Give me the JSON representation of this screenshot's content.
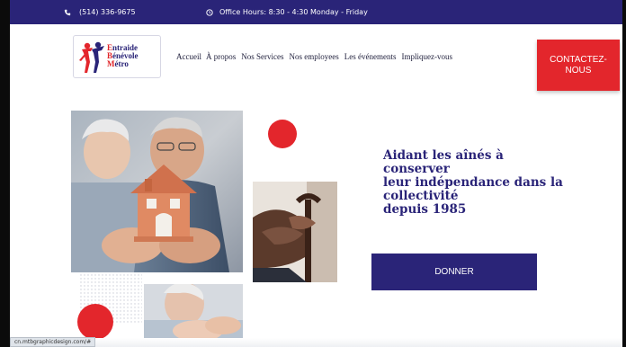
{
  "topbar": {
    "phone": "(514) 336-9675",
    "hours": "Office Hours: 8:30 - 4:30 Monday - Friday",
    "icons": [
      "phone-icon",
      "clock-icon"
    ]
  },
  "logo": {
    "lines": [
      "Entraide",
      "Bénévole",
      "Métro"
    ]
  },
  "nav": {
    "items": [
      "Accueil",
      "À propos",
      "Nos Services",
      "Nos employees",
      "Les événements",
      "Impliquez-vous"
    ]
  },
  "contact_button": {
    "line1": "CONTACTEZ-",
    "line2": "NOUS"
  },
  "hero": {
    "lines": [
      "Aidant les aînés à",
      "conserver",
      "leur indépendance dans la",
      "collectivité",
      "depuis 1985"
    ],
    "donate_label": "DONNER"
  },
  "status_url": "cn.mtbgraphicdesign.com/#",
  "colors": {
    "brand_navy": "#2a2478",
    "accent_red": "#e3262c"
  }
}
